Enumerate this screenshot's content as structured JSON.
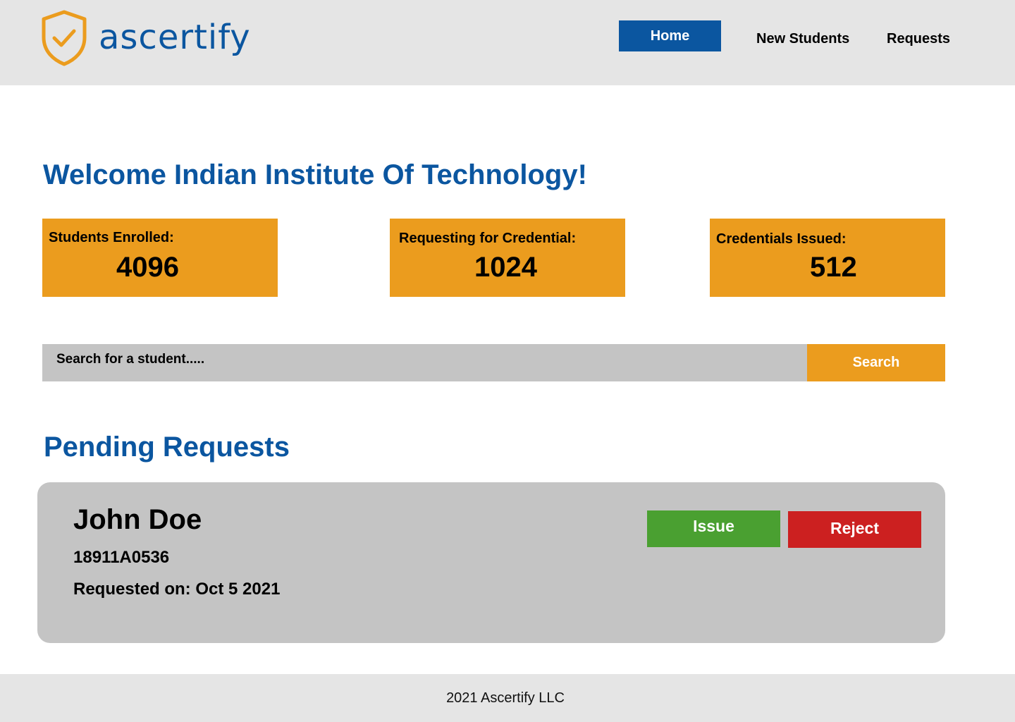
{
  "header": {
    "logo_text": "ascertify",
    "nav": {
      "home": "Home",
      "new_students": "New Students",
      "requests": "Requests"
    }
  },
  "main": {
    "welcome": "Welcome Indian Institute Of Technology!",
    "stats": [
      {
        "label": "Students Enrolled:",
        "value": "4096"
      },
      {
        "label": "Requesting for Credential:",
        "value": "1024"
      },
      {
        "label": "Credentials Issued:",
        "value": "512"
      }
    ],
    "search": {
      "placeholder": "Search for a student.....",
      "button_label": "Search"
    },
    "pending": {
      "title": "Pending Requests",
      "requests": [
        {
          "name": "John Doe",
          "id": "18911A0536",
          "requested_on": "Requested on: Oct 5 2021",
          "issue_label": "Issue",
          "reject_label": "Reject"
        }
      ]
    }
  },
  "footer": {
    "text": "2021 Ascertify LLC"
  },
  "colors": {
    "brand_blue": "#0b56a0",
    "accent_orange": "#eb9c1e",
    "issue_green": "#4aa031",
    "reject_red": "#cc2020",
    "card_gray": "#c4c4c4",
    "header_gray": "#e5e5e5"
  },
  "icons": {
    "logo": "shield-check-icon"
  }
}
